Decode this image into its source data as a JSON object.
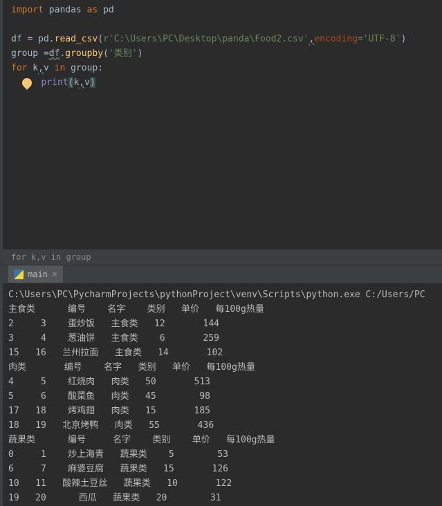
{
  "editor": {
    "l1_import": "import",
    "l1_pandas": " pandas ",
    "l1_as": "as",
    "l1_pd": " pd",
    "l3_df": "df ",
    "l3_eq": "= ",
    "l3_pd": "pd.",
    "l3_read": "read_csv",
    "l3_path": "r'C:\\Users\\PC\\Desktop\\panda\\Food2.csv'",
    "l3_comma": ",",
    "l3_enc": "encoding",
    "l3_utf": "='UTF-8'",
    "l3_close": ")",
    "l4_group": "group ",
    "l4_eq": "=",
    "l4_df": "df",
    "l4_dot": ".",
    "l4_gb": "groupby",
    "l4_open": "(",
    "l4_cat": "'类别'",
    "l4_close": ")",
    "l5_for": "for",
    "l5_k": " k",
    "l5_c": ",",
    "l5_v": "v ",
    "l5_in": "in",
    "l5_grp": " group:",
    "l6_print": "print",
    "l6_open": "(",
    "l6_k": "k",
    "l6_c": ",",
    "l6_v": "v",
    "l6_close": ")"
  },
  "breadcrumb": "for k,v in group",
  "tab": {
    "name": "main"
  },
  "console": {
    "path": "C:\\Users\\PC\\PycharmProjects\\pythonProject\\venv\\Scripts\\python.exe C:/Users/PC",
    "hdr1": "主食类      编号    名字    类别   单价   每100g热量",
    "r1": "2     3    蛋炒饭   主食类   12       144",
    "r2": "3     4    葱油饼   主食类    6       259",
    "r3": "15   16   兰州拉面   主食类   14       102",
    "hdr2": "肉类       编号    名字   类别   单价   每100g热量",
    "r4": "4     5    红烧肉   肉类   50       513",
    "r5": "5     6    酸菜鱼   肉类   45        98",
    "r6": "17   18    烤鸡翅   肉类   15       185",
    "r7": "18   19   北京烤鸭   肉类   55       436",
    "hdr3": "蔬果类      编号     名字    类别    单价   每100g热量",
    "r8": "0     1    炒上海青   蔬果类    5        53",
    "r9": "6     7    麻婆豆腐   蔬果类   15       126",
    "r10": "10   11   酸辣土豆丝   蔬果类   10       122",
    "r11": "19   20      西瓜   蔬果类   20        31"
  }
}
